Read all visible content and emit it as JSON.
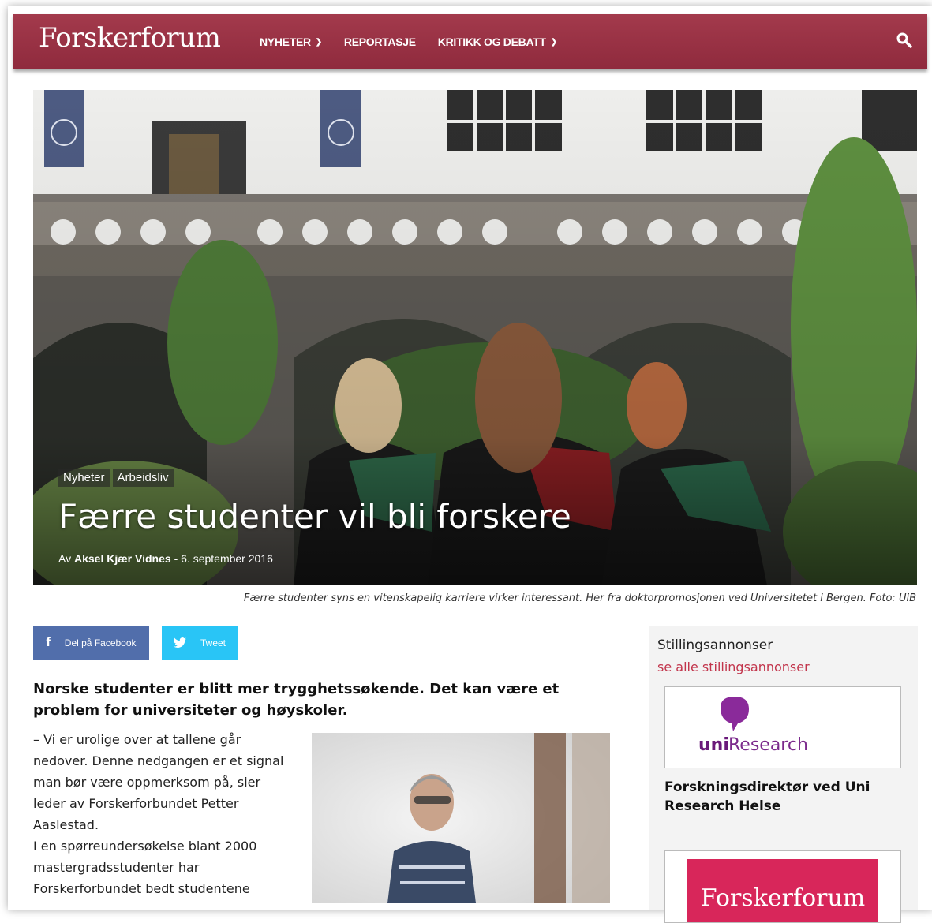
{
  "nav": {
    "logo": "Forskerforum",
    "items": [
      {
        "label": "NYHETER",
        "has_dropdown": true
      },
      {
        "label": "REPORTASJE",
        "has_dropdown": false
      },
      {
        "label": "KRITIKK OG DEBATT",
        "has_dropdown": true
      }
    ],
    "search_icon": "search-icon"
  },
  "hero": {
    "categories": [
      "Nyheter",
      "Arbeidsliv"
    ],
    "title": "Færre studenter vil bli forskere",
    "byline_prefix": "Av",
    "author": "Aksel Kjær Vidnes",
    "separator": "-",
    "date": "6. september 2016",
    "caption": "Færre studenter syns en vitenskapelig karriere virker interessant. Her fra doktorpromosjonen ved Universitetet i Bergen. Foto: UiB"
  },
  "share": {
    "facebook_label": "Del på Facebook",
    "facebook_icon": "f",
    "twitter_label": "Tweet"
  },
  "article": {
    "lead": "Norske studenter er blitt mer trygghetssøkende. Det kan være et problem for universiteter og høyskoler.",
    "paragraphs": [
      "– Vi er urolige over at tallene går nedover. Denne nedgangen er et signal man bør være oppmerksom på, sier leder av Forskerforbundet Petter Aaslestad.",
      "I en spørreundersøkelse blant 2000 mastergradsstudenter har Forskerforbundet bedt studentene"
    ]
  },
  "sidebar": {
    "title": "Stillingsannonser",
    "link": "se alle stillingsannonser",
    "ad1_logo_part1": "uni",
    "ad1_logo_part2": "Research",
    "ad1_title": "Forskningsdirektør ved Uni Research Helse",
    "ad2_logo": "Forskerforum"
  },
  "colors": {
    "nav_bg": "#962f42",
    "accent_link": "#c2354c",
    "facebook": "#516eab",
    "twitter": "#29c5f6",
    "uni_purple": "#7b2a8c",
    "forskerforum_pink": "#d8265a"
  }
}
